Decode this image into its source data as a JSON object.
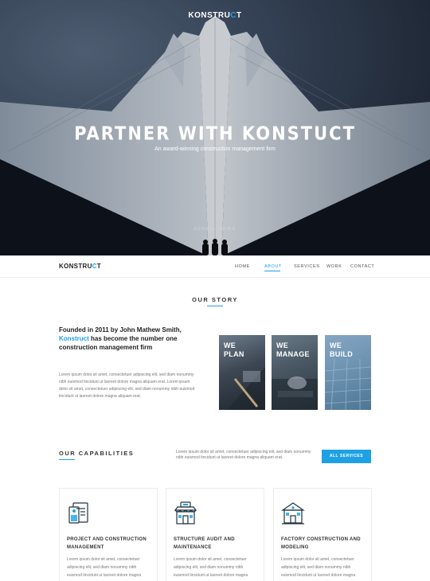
{
  "hero": {
    "logo": "KONSTRU",
    "logo_accent": "C",
    "logo_end": "T",
    "title": "PARTNER WITH KONSTUCT",
    "subtitle": "An award-winning construction management firm",
    "scroll_label": "SCROLL DOWN"
  },
  "nav": {
    "logo": "KONSTRU",
    "logo_accent": "C",
    "logo_end": "T",
    "items": [
      {
        "label": "HOME"
      },
      {
        "label": "ABOUT",
        "active": true
      },
      {
        "label": "SERVICES"
      },
      {
        "label": "WORK"
      },
      {
        "label": "CONTACT"
      }
    ]
  },
  "story": {
    "title": "OUR STORY",
    "heading_pre": "Founded in 2011 by John Mathew Smith, ",
    "heading_accent": "Konstruct",
    "heading_post": " has become the number one construction management firm",
    "body": "Lorem ipsum dolor sit amet, consectetuer adipiscing elit, sed diam nonummy nibh euismod tincidunt ut laoreet dolore magna aliquam erat. Lorem ipsum dolor sit amet, consectetuer adipiscing elit, sed diam nonummy nibh euismod tincidunt ut laoreet dolore magna aliquam erat.",
    "cards": [
      {
        "line1": "WE",
        "line2": "PLAN"
      },
      {
        "line1": "WE",
        "line2": "MANAGE"
      },
      {
        "line1": "WE",
        "line2": "BUILD"
      }
    ]
  },
  "capabilities": {
    "title": "OUR CAPABILITIES",
    "description": "Lorem ipsum dolor sit amet, consectetuer adipiscing elit, sed diam nonummy nibh euismod tincidunt ut laoreet dolore magna aliquam erat.",
    "button_label": "ALL SERVICES",
    "services": [
      {
        "title": "PROJECT AND CONSTRUCTION MANAGEMENT",
        "icon": "documents-icon",
        "text": "Lorem ipsum dolor sit amet, consectetuer adipiscing elit, sed diam nonummy nibh euismod tincidunt ut laoreet dolore magna aliquam erat."
      },
      {
        "title": "STRUCTURE AUDIT AND MAINTENANCE",
        "icon": "storefront-icon",
        "text": "Lorem ipsum dolor sit amet, consectetuer adipiscing elit, sed diam nonummy nibh euismod tincidunt ut laoreet dolore magna aliquam erat."
      },
      {
        "title": "FACTORY CONSTRUCTION AND MODELING",
        "icon": "building-icon",
        "text": "Lorem ipsum dolor sit amet, consectetuer adipiscing elit, sed diam nonummy nibh euismod tincidunt ut laoreet dolore magna aliquam erat."
      }
    ]
  },
  "colors": {
    "accent": "#1ea1e3",
    "text": "#222222",
    "muted": "#777777"
  }
}
